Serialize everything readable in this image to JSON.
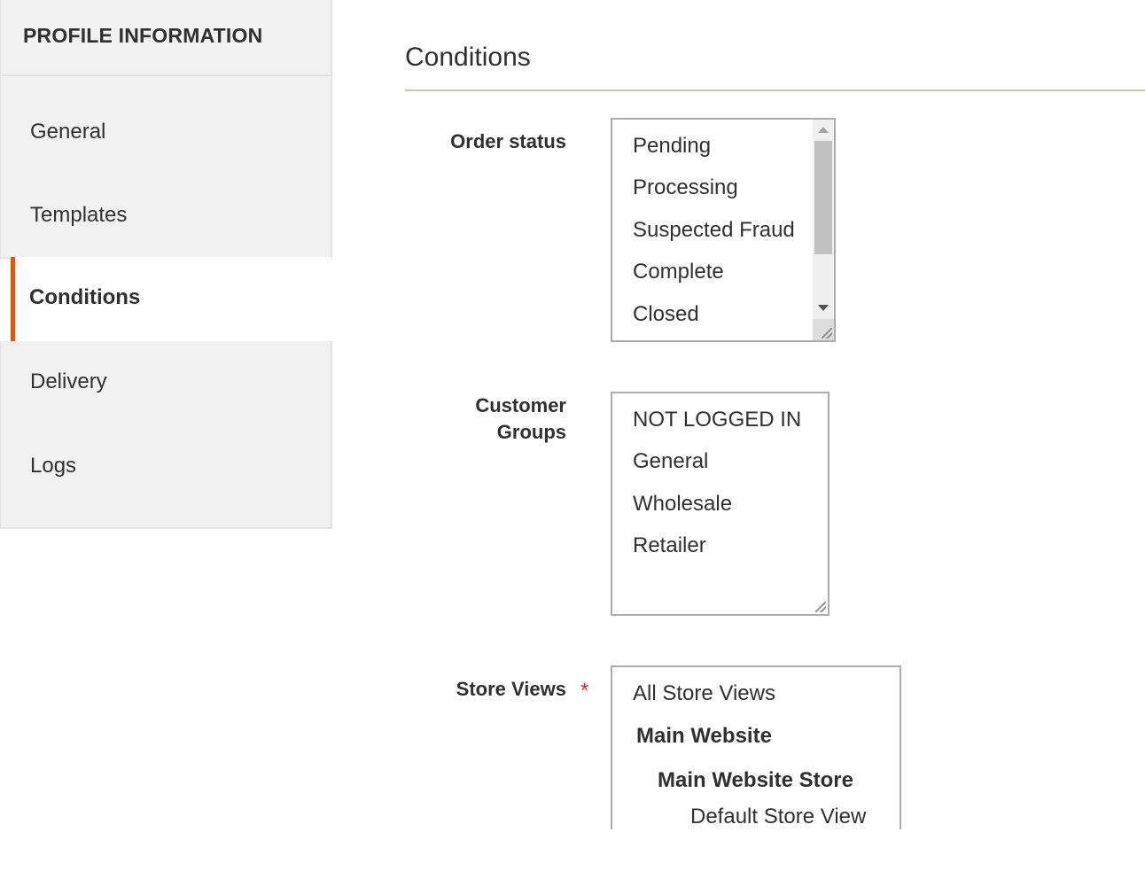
{
  "sidebar": {
    "title": "PROFILE INFORMATION",
    "items": [
      {
        "label": "General",
        "active": false
      },
      {
        "label": "Templates",
        "active": false
      },
      {
        "label": "Conditions",
        "active": true
      },
      {
        "label": "Delivery",
        "active": false
      },
      {
        "label": "Logs",
        "active": false
      }
    ],
    "accent_color": "#eb5202"
  },
  "main": {
    "title": "Conditions",
    "fields": {
      "order_status": {
        "label": "Order status",
        "options": [
          "Pending",
          "Processing",
          "Suspected Fraud",
          "Complete",
          "Closed"
        ]
      },
      "customer_groups": {
        "label_line1": "Customer",
        "label_line2": "Groups",
        "options": [
          "NOT LOGGED IN",
          "General",
          "Wholesale",
          "Retailer"
        ]
      },
      "store_views": {
        "label": "Store Views",
        "required_marker": "*",
        "options": {
          "all": "All Store Views",
          "website": "Main Website",
          "store": "Main Website Store",
          "view": "Default Store View"
        }
      }
    }
  }
}
